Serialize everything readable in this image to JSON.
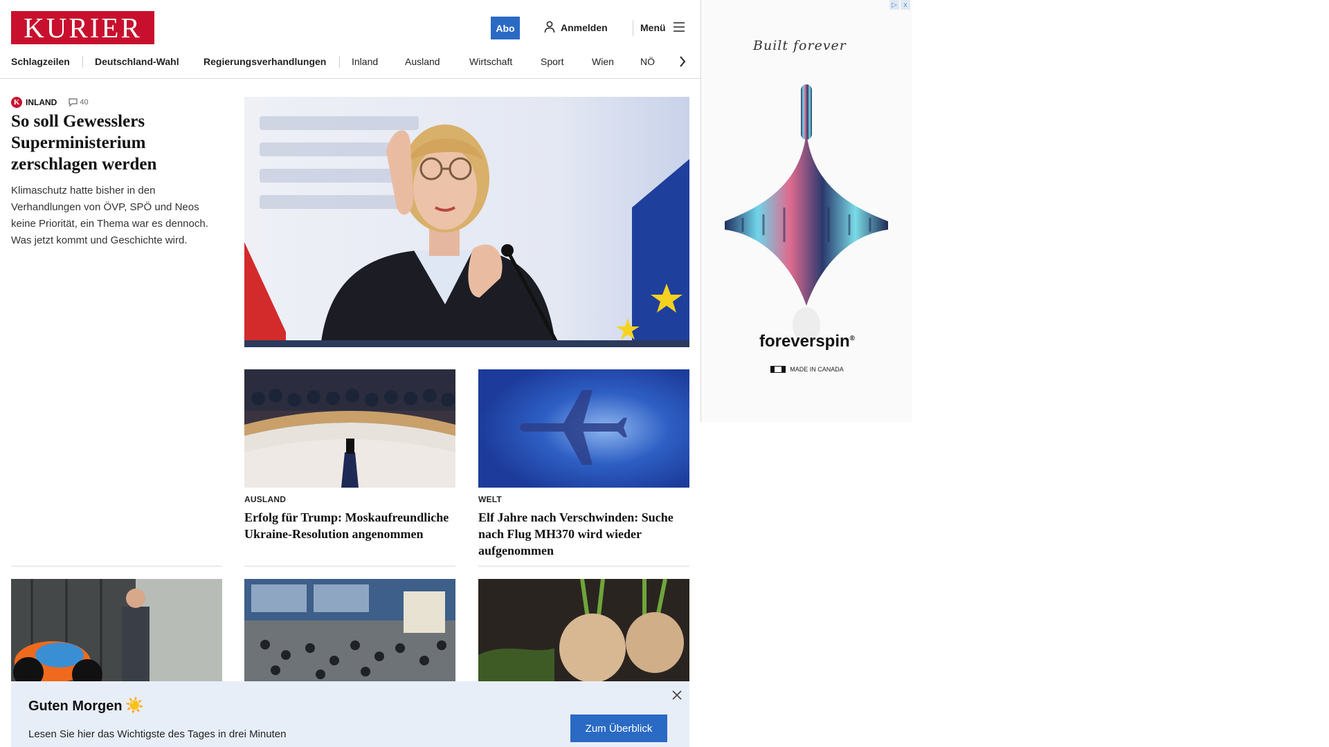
{
  "header": {
    "logo": "KURIER",
    "abo_label": "Abo",
    "login_label": "Anmelden",
    "menu_label": "Menü"
  },
  "nav": {
    "items": [
      "Schlagzeilen",
      "Deutschland-Wahl",
      "Regierungsverhandlungen",
      "Inland",
      "Ausland",
      "Wirtschaft",
      "Sport",
      "Wien",
      "NÖ"
    ]
  },
  "lead": {
    "badge": "K",
    "category": "INLAND",
    "comments": "40",
    "title": "So soll Gewesslers Superministerium zerschlagen werden",
    "teaser": "Klimaschutz hatte bisher in den Verhandlungen von ÖVP, SPÖ und Neos keine Priorität, ein Thema war es dennoch. Was jetzt kommt und Geschichte wird."
  },
  "stories": [
    {
      "category": "AUSLAND",
      "title": "Erfolg für Trump: Moskaufreundliche Ukraine-Resolution angenommen"
    },
    {
      "category": "WELT",
      "title": "Elf Jahre nach Verschwinden: Suche nach Flug MH370 wird wieder aufgenommen"
    }
  ],
  "morning": {
    "title": "Guten Morgen",
    "sun": "☀️",
    "text": "Lesen Sie hier das Wichtigste des Tages in drei Minuten",
    "button": "Zum Überblick"
  },
  "ad": {
    "tagline": "Built forever",
    "brand": "foreverspin",
    "registered": "®",
    "origin": "MADE IN CANADA",
    "choices_icon": "ad-choices-icon",
    "close_icon": "x"
  },
  "colors": {
    "brand_red": "#c8102e",
    "accent_blue": "#2a6ac4",
    "banner_bg": "#e8eef8"
  }
}
